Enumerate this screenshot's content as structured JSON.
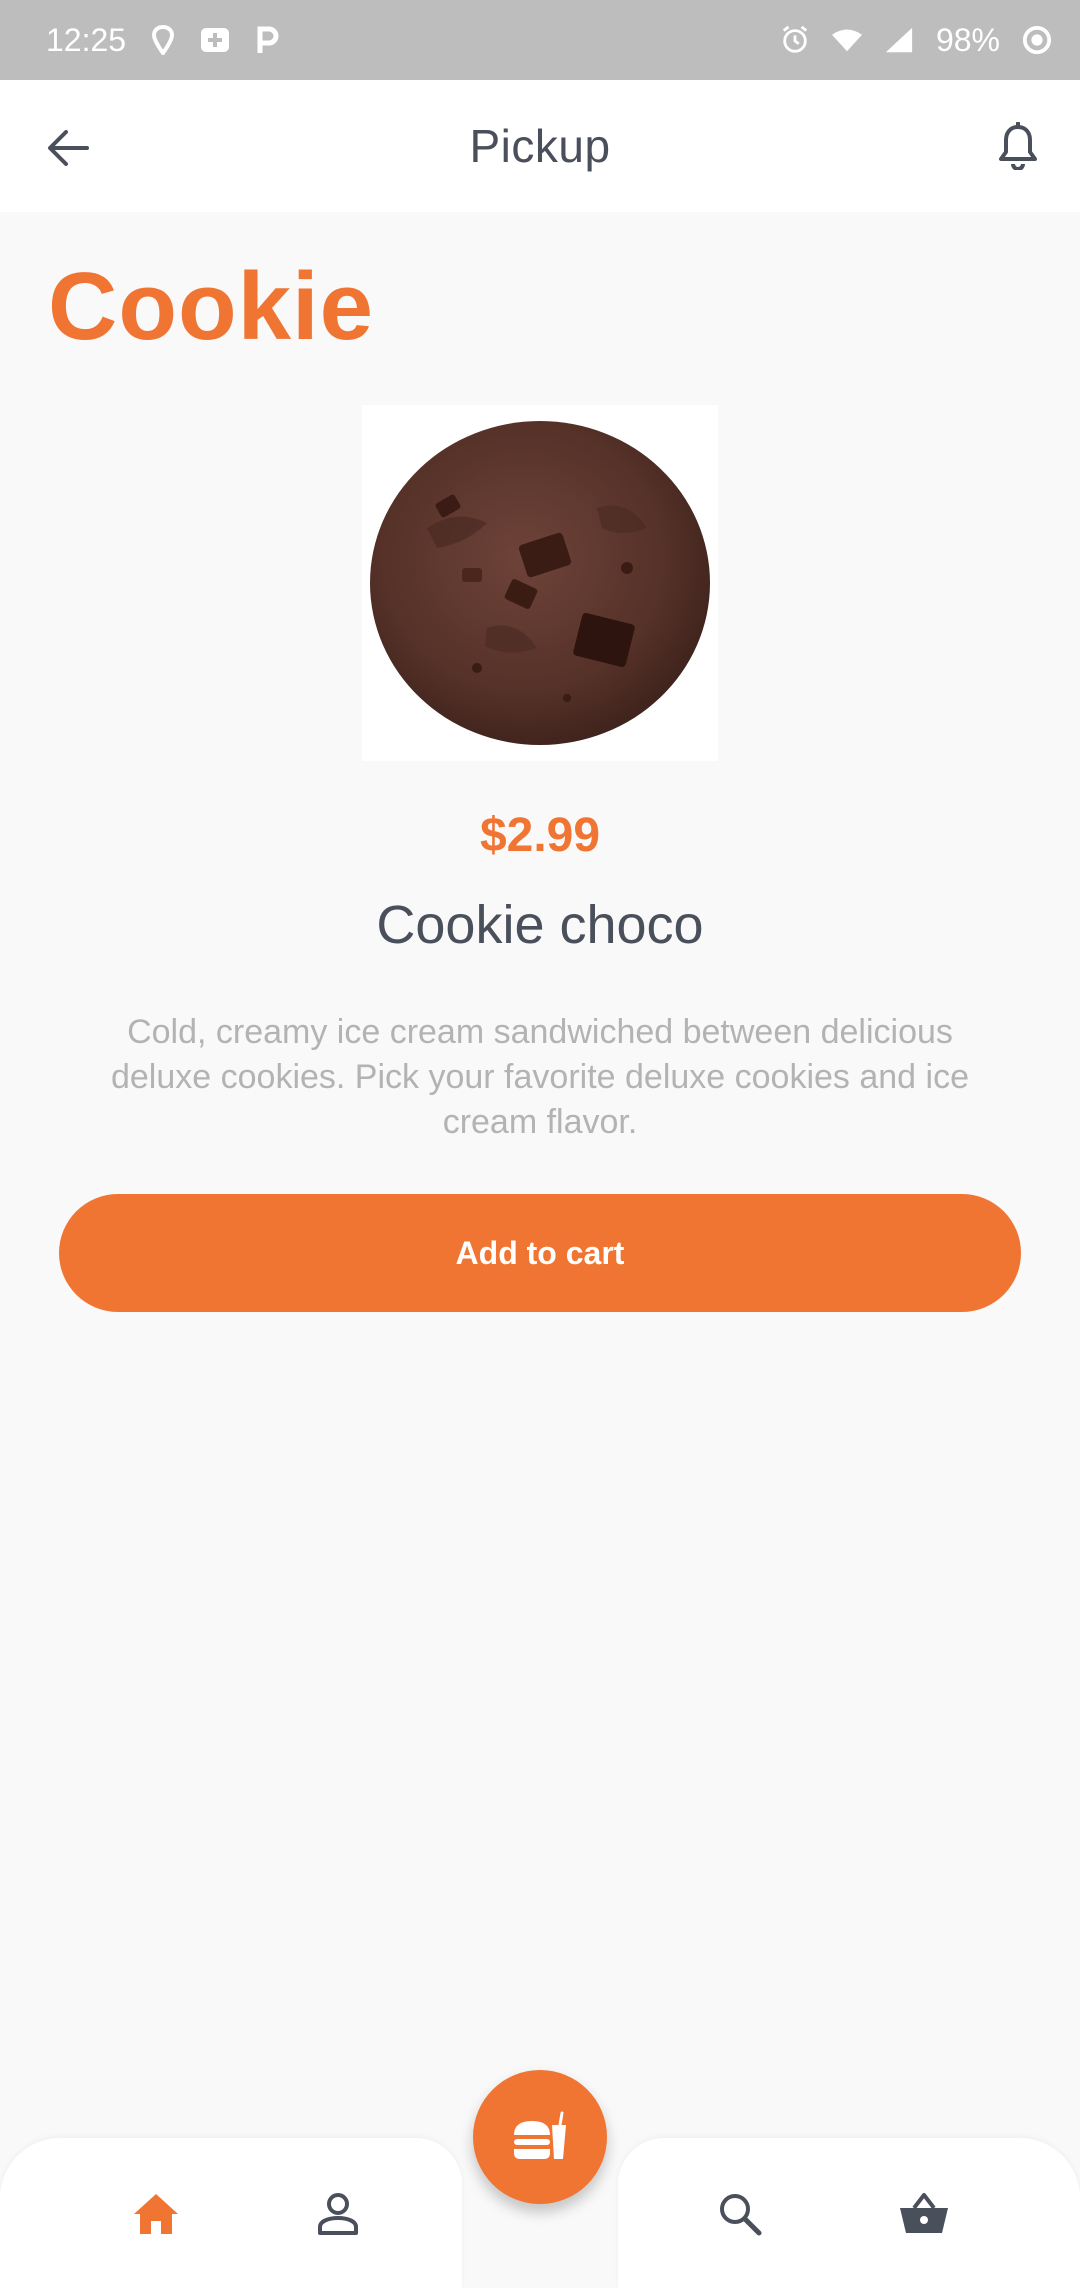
{
  "status_bar": {
    "time": "12:25",
    "battery": "98%",
    "icons": [
      "maps-pin-icon",
      "health-plus-icon",
      "parking-icon",
      "alarm-icon",
      "wifi-icon",
      "signal-icon",
      "battery-ring-icon"
    ]
  },
  "app_bar": {
    "title": "Pickup",
    "back_icon": "arrow-left-icon",
    "bell_icon": "bell-icon"
  },
  "category": {
    "title": "Cookie"
  },
  "product": {
    "image": "cookie-image",
    "price": "$2.99",
    "name": "Cookie choco",
    "description": "Cold, creamy ice cream sandwiched between delicious deluxe cookies. Pick your favorite deluxe cookies and ice cream flavor."
  },
  "actions": {
    "add_to_cart_label": "Add to cart"
  },
  "bottom_nav": {
    "items": [
      {
        "icon": "home-icon",
        "active": true
      },
      {
        "icon": "person-icon",
        "active": false
      },
      {
        "icon": "food-icon",
        "active": false
      },
      {
        "icon": "search-icon",
        "active": false
      },
      {
        "icon": "basket-icon",
        "active": false
      }
    ]
  },
  "colors": {
    "accent": "#f07533",
    "text_dark": "#4a4f5c",
    "text_muted": "#b3b3b3",
    "background": "#f9f9f9",
    "status_bar": "#bdbdbd"
  }
}
